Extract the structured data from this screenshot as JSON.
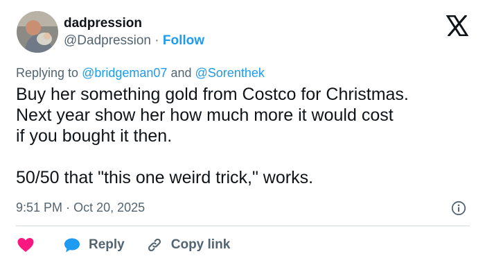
{
  "user": {
    "display_name": "dadpression",
    "handle": "@Dadpression",
    "separator": "·",
    "follow_label": "Follow"
  },
  "replying": {
    "prefix": "Replying to",
    "mentions": [
      "@bridgeman07",
      "@Sorenthek"
    ],
    "conjunction": "and"
  },
  "tweet": {
    "lines": [
      "Buy her something gold from Costco for Christmas.",
      "Next year show her how much more it would cost",
      "if you bought it then."
    ],
    "line2": "50/50 that \"this one weird trick,\" works."
  },
  "meta": {
    "time": "9:51 PM",
    "separator": "·",
    "date": "Oct 20, 2025"
  },
  "actions": {
    "reply_label": "Reply",
    "copy_link_label": "Copy link"
  },
  "colors": {
    "accent": "#1d9bf0",
    "heart": "#f91880",
    "text": "#0f1419",
    "muted": "#536471",
    "divider": "#cfd9de"
  },
  "icons": {
    "brand": "x-logo-icon",
    "info": "info-icon",
    "like": "heart-icon",
    "reply": "speech-bubble-icon",
    "copy": "link-icon"
  }
}
